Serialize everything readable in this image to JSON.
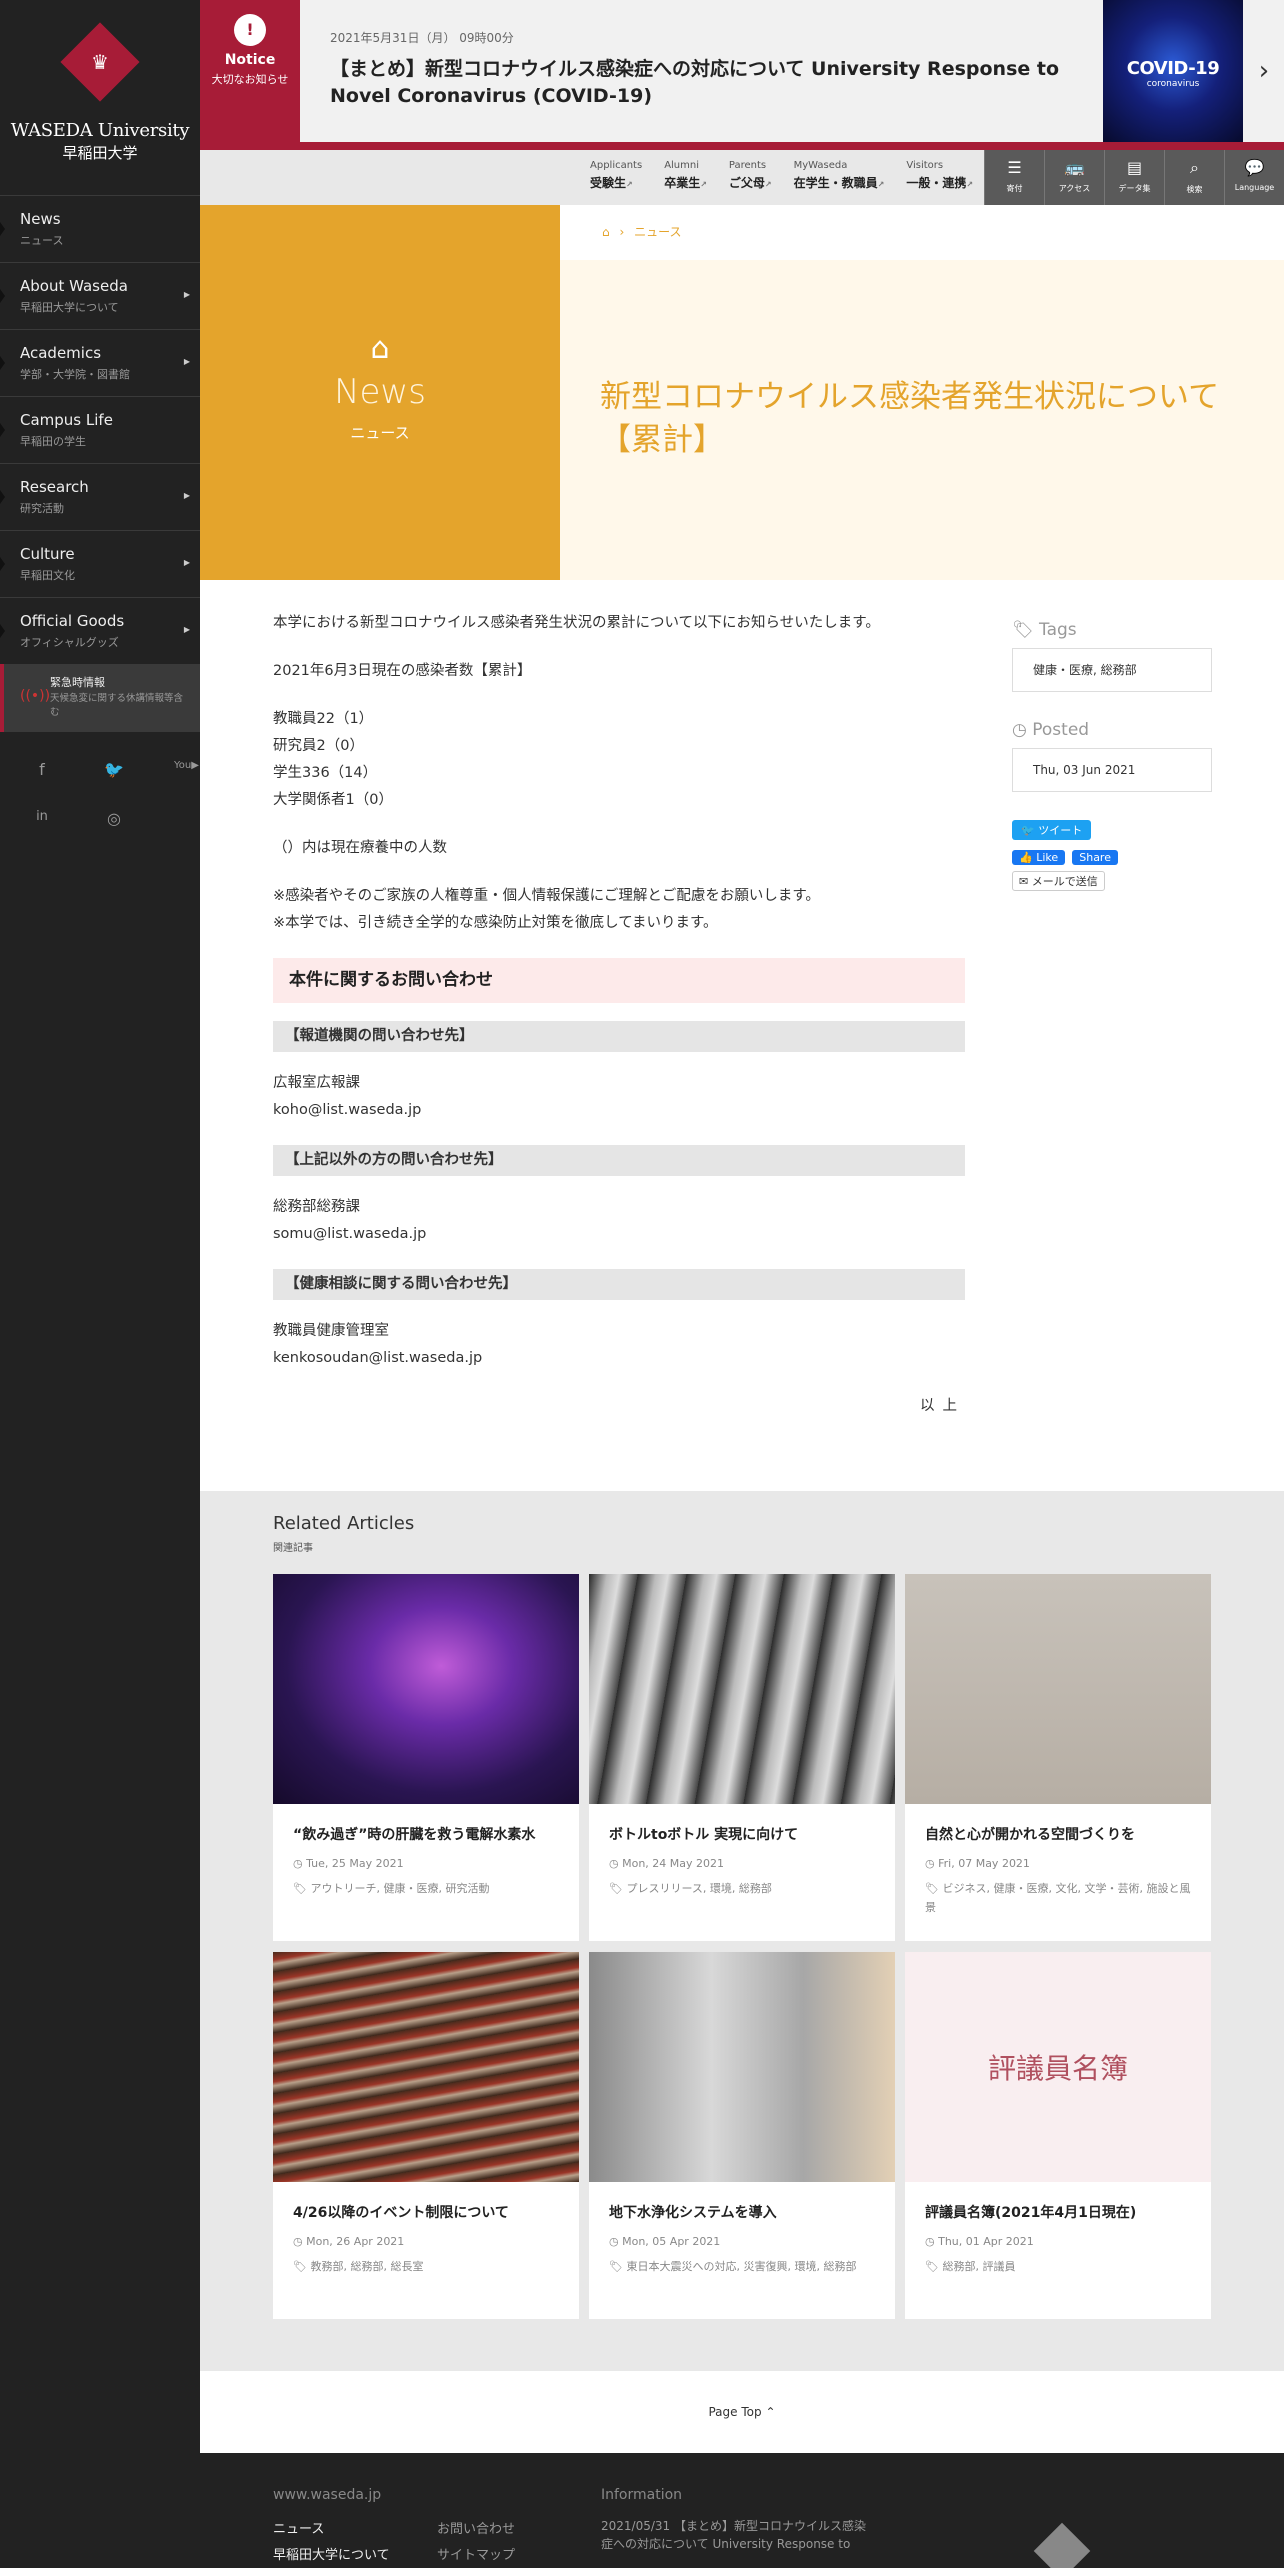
{
  "sidebar": {
    "logo_en": "WASEDA University",
    "logo_ja": "早稲田大学",
    "items": [
      {
        "en": "News",
        "ja": "ニュース",
        "arrow": false
      },
      {
        "en": "About Waseda",
        "ja": "早稲田大学について",
        "arrow": true
      },
      {
        "en": "Academics",
        "ja": "学部・大学院・図書館",
        "arrow": true
      },
      {
        "en": "Campus Life",
        "ja": "早稲田の学生",
        "arrow": false
      },
      {
        "en": "Research",
        "ja": "研究活動",
        "arrow": true
      },
      {
        "en": "Culture",
        "ja": "早稲田文化",
        "arrow": true
      },
      {
        "en": "Official Goods",
        "ja": "オフィシャルグッズ",
        "arrow": true
      }
    ],
    "emergency": {
      "title": "緊急時情報",
      "sub": "天候急変に関する休講情報等含む"
    }
  },
  "notice": {
    "label": "Notice",
    "sub": "大切なお知らせ",
    "date": "2021年5月31日（月） 09時00分",
    "title": "【まとめ】新型コロナウイルス感染症への対応について University Response to Novel Coronavirus (COVID-19)",
    "image_text": "COVID-19",
    "image_sub": "coronavirus"
  },
  "audience": [
    {
      "en": "Applicants",
      "ja": "受験生"
    },
    {
      "en": "Alumni",
      "ja": "卒業生"
    },
    {
      "en": "Parents",
      "ja": "ご父母"
    },
    {
      "en": "MyWaseda",
      "ja": "在学生・教職員"
    },
    {
      "en": "Visitors",
      "ja": "一般・連携"
    }
  ],
  "tools": [
    {
      "label": "寄付",
      "icon": "database-icon"
    },
    {
      "label": "アクセス",
      "icon": "bus-icon"
    },
    {
      "label": "データ集",
      "icon": "book-icon"
    },
    {
      "label": "検索",
      "icon": "search-icon"
    },
    {
      "label": "Language",
      "icon": "chat-icon"
    }
  ],
  "hero": {
    "section_en": "News",
    "section_ja": "ニュース",
    "breadcrumb": "ニュース",
    "title": "新型コロナウイルス感染者発生状況について【累計】"
  },
  "article": {
    "intro": "本学における新型コロナウイルス感染者発生状況の累計について以下にお知らせいたします。",
    "as_of": "2021年6月3日現在の感染者数【累計】",
    "counts": [
      "教職員22（1）",
      "研究員2（0）",
      "学生336（14）",
      "大学関係者1（0）"
    ],
    "note": "（）内は現在療養中の人数",
    "request1": "※感染者やそのご家族の人権尊重・個人情報保護にご理解とご配慮をお願いします。",
    "request2": "※本学では、引き続き全学的な感染防止対策を徹底してまいります。",
    "contact_heading": "本件に関するお問い合わせ",
    "contacts": [
      {
        "heading": "【報道機関の問い合わせ先】",
        "dept": "広報室広報課",
        "email": "koho@list.waseda.jp"
      },
      {
        "heading": "【上記以外の方の問い合わせ先】",
        "dept": "総務部総務課",
        "email": "somu@list.waseda.jp"
      },
      {
        "heading": "【健康相談に関する問い合わせ先】",
        "dept": "教職員健康管理室",
        "email": "kenkosoudan@list.waseda.jp"
      }
    ],
    "end": "以上"
  },
  "side": {
    "tags_label": "Tags",
    "tags": "健康・医療, 総務部",
    "posted_label": "Posted",
    "posted": "Thu, 03 Jun 2021",
    "tweet": "ツイート",
    "like": "Like",
    "share": "Share",
    "mail": "メールで送信"
  },
  "related": {
    "title": "Related Articles",
    "sub": "関連記事",
    "cards": [
      {
        "title": "“飲み過ぎ”時の肝臓を救う電解水素水",
        "date": "Tue, 25 May 2021",
        "tags": "アウトリーチ, 健康・医療, 研究活動",
        "img": ""
      },
      {
        "title": "ボトルtoボトル 実現に向けて",
        "date": "Mon, 24 May 2021",
        "tags": "プレスリリース, 環境, 総務部",
        "img": ""
      },
      {
        "title": "自然と心が開かれる空間づくりを",
        "date": "Fri, 07 May 2021",
        "tags": "ビジネス, 健康・医療, 文化, 文学・芸術, 施設と風景",
        "img": ""
      },
      {
        "title": "4/26以降のイベント制限について",
        "date": "Mon, 26 Apr 2021",
        "tags": "教務部, 総務部, 総長室",
        "img": ""
      },
      {
        "title": "地下水浄化システムを導入",
        "date": "Mon, 05 Apr 2021",
        "tags": "東日本大震災への対応, 災害復興, 環境, 総務部",
        "img": ""
      },
      {
        "title": "評議員名簿(2021年4月1日現在)",
        "date": "Thu, 01 Apr 2021",
        "tags": "総務部, 評議員",
        "img": "評議員名簿"
      }
    ]
  },
  "page_top": "Page Top",
  "footer": {
    "site": "www.waseda.jp",
    "links1": [
      "ニュース",
      "早稲田大学について"
    ],
    "links2": [
      "お問い合わせ",
      "サイトマップ"
    ],
    "info_title": "Information",
    "info_text": "2021/05/31 【まとめ】新型コロナウイルス感染症への対応について University Response to"
  }
}
